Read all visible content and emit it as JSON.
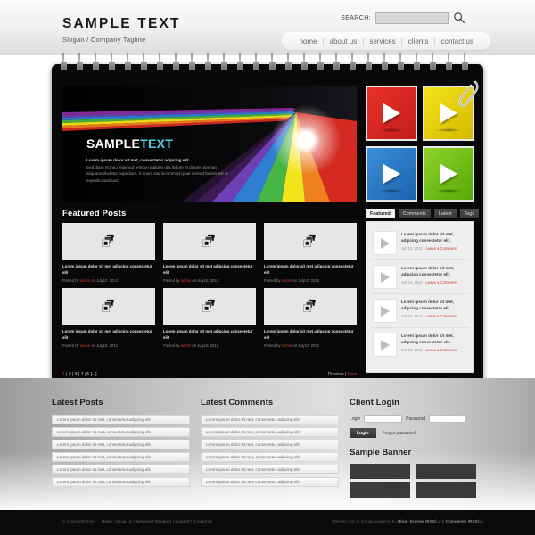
{
  "header": {
    "logo_title": "SAMPLE TEXT",
    "logo_tagline": "Slogan / Company Tagline",
    "search_label": "SEARCH:",
    "search_value": "",
    "search_placeholder": "",
    "search_icon": "search-icon",
    "nav": [
      {
        "label": "home"
      },
      {
        "label": "about us"
      },
      {
        "label": "services"
      },
      {
        "label": "clients"
      },
      {
        "label": "contact us"
      }
    ],
    "nav_separator": "|"
  },
  "hero": {
    "title_part1": "SAMPLE",
    "title_part2": "TEXT",
    "lead": "Lorem ipsum dolor sit met, consectetur adipcing elit",
    "body": "Sed diam monnu eiusmod tempon indiden utia labore et dolore monnag aliquammihidetur expedium. It eruim situ incommod quae dereud faciles est er expedit diastinact.",
    "rainbow_colors": [
      "#d42a22",
      "#f07f1e",
      "#f2e41a",
      "#46b546",
      "#2e7fd4",
      "#6f3fb5",
      "#8e2aa0"
    ],
    "glow": "light-burst"
  },
  "tiles": [
    {
      "name": "tile-red",
      "color": "#e8312a",
      "icon": "play-icon"
    },
    {
      "name": "tile-yellow",
      "color": "#f2e41a",
      "icon": "play-icon"
    },
    {
      "name": "tile-blue",
      "color": "#3a8fd8",
      "icon": "play-icon"
    },
    {
      "name": "tile-green",
      "color": "#8ed429",
      "icon": "play-icon"
    }
  ],
  "featured": {
    "title": "Featured Posts",
    "posts": [
      {
        "title": "Lorem ipsum dolor sit met adipcing consectetur elit",
        "meta_prefix": "Posted by ",
        "author": "admin",
        "meta_suffix": " on July10, 2012"
      },
      {
        "title": "Lorem ipsum dolor sit met adipcing consectetur elit",
        "meta_prefix": "Posted by ",
        "author": "admin",
        "meta_suffix": " on July10, 2012"
      },
      {
        "title": "Lorem ipsum dolor sit met adipcing consectetur elit",
        "meta_prefix": "Posted by ",
        "author": "admin",
        "meta_suffix": " on July10, 2012"
      },
      {
        "title": "Lorem ipsum dolor sit met adipcing consectetur elit",
        "meta_prefix": "Posted by ",
        "author": "admin",
        "meta_suffix": " on July10, 2012"
      },
      {
        "title": "Lorem ipsum dolor sit met adipcing consectetur elit",
        "meta_prefix": "Posted by ",
        "author": "admin",
        "meta_suffix": " on July10, 2012"
      },
      {
        "title": "Lorem ipsum dolor sit met adipcing consectetur elit",
        "meta_prefix": "Posted by ",
        "author": "admin",
        "meta_suffix": " on July10, 2012"
      }
    ],
    "pager_pages": "1 | 2 | 3 | 4 | 5 [...]",
    "pager_current": "1",
    "pager_rest": " | 2 | 3 | 4 | 5 [...]",
    "pager_prev": "Preview",
    "pager_div": " | ",
    "pager_next": "Next"
  },
  "sidebar": {
    "tabs": [
      {
        "label": "Featured",
        "active": true
      },
      {
        "label": "Comments",
        "active": false
      },
      {
        "label": "Latest",
        "active": false
      },
      {
        "label": "Tags",
        "active": false
      }
    ],
    "items": [
      {
        "title": "Lorem ipsum dolor sit met, adipcing consectetur elit.",
        "date": "July10, 2012",
        "sep": " · ",
        "action": "Leave a Comment"
      },
      {
        "title": "Lorem ipsum dolor sit met, adipcing consectetur elit.",
        "date": "July10, 2012",
        "sep": " · ",
        "action": "Leave a Comment"
      },
      {
        "title": "Lorem ipsum dolor sit met, adipcing consectetur elit.",
        "date": "July10, 2012",
        "sep": " · ",
        "action": "Leave a Comment"
      },
      {
        "title": "Lorem ipsum dolor sit met, adipcing consectetur elit.",
        "date": "July10, 2012",
        "sep": " · ",
        "action": "Leave a Comment"
      }
    ]
  },
  "latest_posts": {
    "title": "Latest Posts",
    "rows": [
      "Lorem ipsum dolor sit met, consectetur adipcing elit",
      "Lorem ipsum dolor sit met, consectetur adipcing elit",
      "Lorem ipsum dolor sit met, consectetur adipcing elit",
      "Lorem ipsum dolor sit met, consectetur adipcing elit",
      "Lorem ipsum dolor sit met, consectetur adipcing elit",
      "Lorem ipsum dolor sit met, consectetur adipcing elit"
    ]
  },
  "latest_comments": {
    "title": "Latest Comments",
    "rows": [
      "Lorem ipsum dolor sit met, consectetur adipcing elit",
      "Lorem ipsum dolor sit met, consectetur adipcing elit",
      "Lorem ipsum dolor sit met, consectetur adipcing elit",
      "Lorem ipsum dolor sit met, consectetur adipcing elit",
      "Lorem ipsum dolor sit met, consectetur adipcing elit",
      "Lorem ipsum dolor sit met, consectetur adipcing elit"
    ]
  },
  "client_login": {
    "title": "Client Login",
    "login_label": "Login",
    "login_value": "",
    "password_label": "Password",
    "password_value": "",
    "submit_label": "Login",
    "forgot_label": "Forgot password"
  },
  "sample_banner": {
    "title": "Sample Banner",
    "boxes": [
      "banner-1",
      "banner-2",
      "banner-3",
      "banner-4"
    ]
  },
  "footer": {
    "copyright": "© Copyright/footer",
    "links": "Home | About Us | Services | Solutions | Support | Contact us",
    "powered_prefix": "Website.com is proudly powered by ",
    "powered_blog": "Blog",
    "powered_sep1": " | ",
    "powered_entries": "Entries (RSS)",
    "powered_and": " and ",
    "powered_comments": "Comments (RSS)",
    "powered_suffix": "va"
  }
}
